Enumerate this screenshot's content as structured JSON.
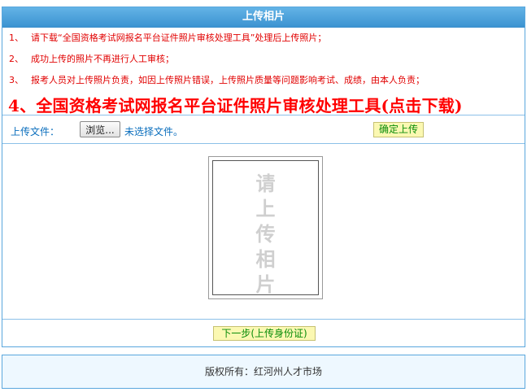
{
  "header": {
    "title": "上传相片"
  },
  "notes": [
    {
      "num": "1、",
      "text": "请下载“全国资格考试网报名平台证件照片审核处理工具”处理后上传照片；"
    },
    {
      "num": "2、",
      "text": "成功上传的照片不再进行人工审核；"
    },
    {
      "num": "3、",
      "text": "报考人员对上传照片负责，如因上传照片错误，上传照片质量等问题影响考试、成绩，由本人负责；"
    }
  ],
  "download_link": "4、全国资格考试网报名平台证件照片审核处理工具(点击下载)",
  "upload": {
    "label": "上传文件：",
    "browse_label": "浏览...",
    "no_file_text": "未选择文件。",
    "confirm_label": "确定上传"
  },
  "photo_placeholder": [
    "请",
    "上",
    "传",
    "相",
    "片"
  ],
  "next_label": "下一步(上传身份证)",
  "footer": {
    "text": "版权所有：红河州人才市场"
  }
}
